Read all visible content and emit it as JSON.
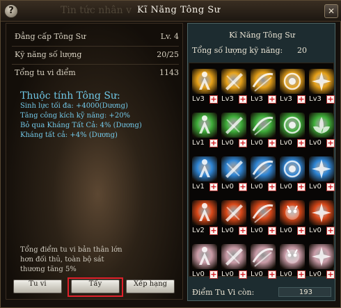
{
  "window": {
    "background_title": "Tin tức nhân v",
    "title": "Kĩ Năng Tông Sư"
  },
  "left": {
    "stats": [
      {
        "label": "Đẳng cấp Tông Sư",
        "value": "Lv. 4"
      },
      {
        "label": "Kỹ năng số lượng",
        "value": "20/25"
      },
      {
        "label": "Tổng tu vi điểm",
        "value": "1143"
      }
    ],
    "attributes_title": "Thuộc tính Tông Sư:",
    "attributes": [
      "Sinh lực tối đa: +4000(Dương)",
      "Tăng công kích kỹ năng: +20%",
      "Bỏ qua Kháng Tất Cả: 4% (Dương)",
      "Kháng tất cả: +4% (Dương)"
    ],
    "description": [
      "Tổng điểm tu vi bản thân lớn",
      "hơn đối thủ, toàn bộ sát",
      "thương tăng 5%"
    ],
    "buttons": {
      "tu_vi": "Tu vi",
      "tay": "Tẩy",
      "xep_hang": "Xếp hạng"
    }
  },
  "right": {
    "title": "Kĩ Năng Tông Sư",
    "total_label": "Tổng số lượng kỹ năng:",
    "total_value": "20",
    "points_label": "Điểm Tu Vi còn:",
    "points_value": "193",
    "plus_symbol": "+",
    "skills": [
      {
        "level": "Lv3",
        "icon": "golden-figure-icon",
        "color": "#e7a21a"
      },
      {
        "level": "Lv3",
        "icon": "golden-blade-icon",
        "color": "#e7a21a"
      },
      {
        "level": "Lv3",
        "icon": "golden-slash-icon",
        "color": "#e7a21a"
      },
      {
        "level": "Lv3",
        "icon": "golden-spiral-icon",
        "color": "#e7a21a"
      },
      {
        "level": "Lv3",
        "icon": "golden-burst-icon",
        "color": "#e7a21a"
      },
      {
        "level": "Lv1",
        "icon": "green-figure-icon",
        "color": "#3fae3a"
      },
      {
        "level": "Lv0",
        "icon": "green-blade-icon",
        "color": "#3fae3a"
      },
      {
        "level": "Lv0",
        "icon": "green-slash-icon",
        "color": "#3fae3a"
      },
      {
        "level": "Lv0",
        "icon": "green-spiral-icon",
        "color": "#3fae3a"
      },
      {
        "level": "Lv0",
        "icon": "green-lotus-icon",
        "color": "#3fae3a"
      },
      {
        "level": "Lv1",
        "icon": "blue-figure-icon",
        "color": "#2f86d6"
      },
      {
        "level": "Lv0",
        "icon": "blue-blade-icon",
        "color": "#2f86d6"
      },
      {
        "level": "Lv0",
        "icon": "blue-slash-icon",
        "color": "#2f86d6"
      },
      {
        "level": "Lv0",
        "icon": "blue-spiral-icon",
        "color": "#2f86d6"
      },
      {
        "level": "Lv0",
        "icon": "blue-burst-icon",
        "color": "#2f86d6"
      },
      {
        "level": "Lv2",
        "icon": "red-figure-icon",
        "color": "#d9491a"
      },
      {
        "level": "Lv0",
        "icon": "red-blade-icon",
        "color": "#d9491a"
      },
      {
        "level": "Lv0",
        "icon": "red-slash-icon",
        "color": "#d9491a"
      },
      {
        "level": "Lv0",
        "icon": "red-demon-icon",
        "color": "#d9491a"
      },
      {
        "level": "Lv0",
        "icon": "red-burst-icon",
        "color": "#d9491a"
      },
      {
        "level": "Lv0",
        "icon": "pink-figure-icon",
        "color": "#c89aa6"
      },
      {
        "level": "Lv0",
        "icon": "pink-blade-icon",
        "color": "#c89aa6"
      },
      {
        "level": "Lv0",
        "icon": "pink-slash-icon",
        "color": "#c89aa6"
      },
      {
        "level": "Lv0",
        "icon": "pink-demon-icon",
        "color": "#c89aa6"
      },
      {
        "level": "Lv0",
        "icon": "pink-burst-icon",
        "color": "#c89aa6"
      }
    ]
  }
}
